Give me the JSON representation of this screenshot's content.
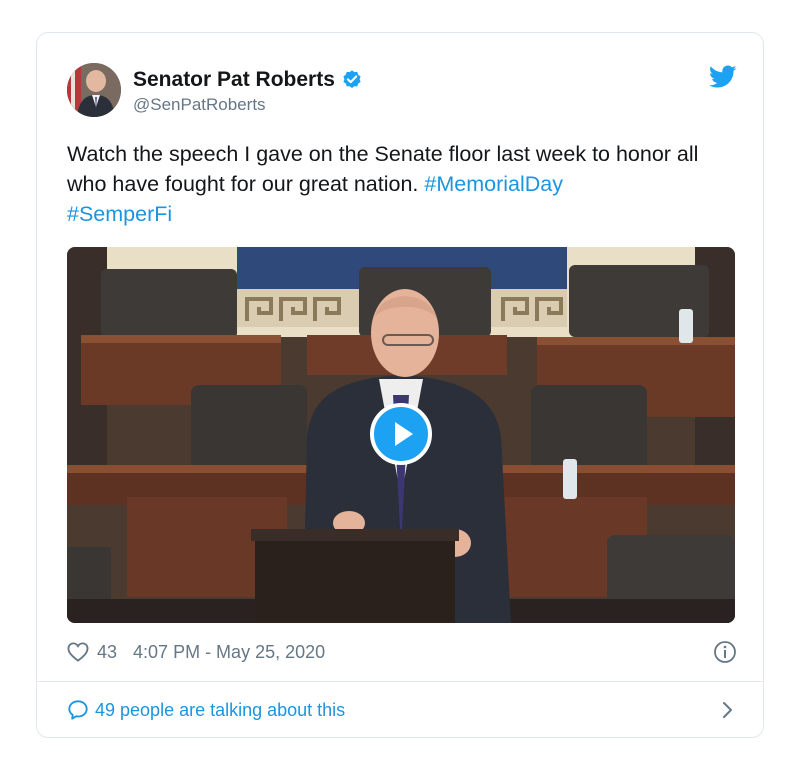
{
  "tweet": {
    "display_name": "Senator Pat Roberts",
    "handle": "@SenPatRoberts",
    "text_main": "Watch the speech I gave on the Senate floor last week to honor all who have fought for our great nation. ",
    "hashtags": [
      "#MemorialDay",
      "#SemperFi"
    ],
    "like_count": "43",
    "timestamp": "4:07 PM - May 25, 2020",
    "talking_label": "49 people are talking about this"
  },
  "icons": {
    "verified": "verified-badge-icon",
    "brand": "twitter-bird-icon",
    "like": "heart-icon",
    "info": "info-icon",
    "reply": "speech-bubble-icon",
    "more": "chevron-right-icon",
    "play": "play-icon"
  },
  "colors": {
    "brand_blue": "#1da1f2",
    "link_blue": "#1b95e0",
    "text_primary": "#14171a",
    "text_secondary": "#657786",
    "border": "#e1e8ed"
  }
}
